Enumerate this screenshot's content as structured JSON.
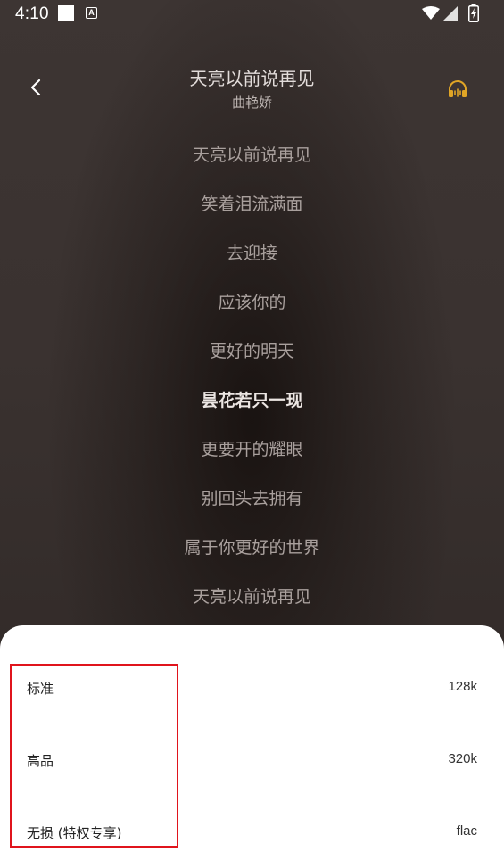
{
  "status_bar": {
    "time": "4:10",
    "a_icon_letter": "A",
    "icons": [
      "notification-square-icon",
      "a-notification-icon",
      "wifi-icon",
      "signal-icon",
      "battery-charging-icon"
    ]
  },
  "header": {
    "title": "天亮以前说再见",
    "artist": "曲艳娇",
    "back_icon": "chevron-left-icon",
    "headphones_icon": "headphones-icon"
  },
  "lyrics": {
    "lines": [
      "天亮以前说再见",
      "笑着泪流满面",
      "去迎接",
      "应该你的",
      "更好的明天",
      "昙花若只一现",
      "更要开的耀眼",
      "别回头去拥有",
      "属于你更好的世界",
      "天亮以前说再见"
    ],
    "active_index": 5
  },
  "quality_sheet": {
    "options": [
      {
        "label": "标准",
        "rate": "128k"
      },
      {
        "label": "高品",
        "rate": "320k"
      },
      {
        "label": "无损 (特权专享)",
        "rate": "flac"
      }
    ]
  },
  "colors": {
    "background": "#3a3230",
    "highlight_border": "#e0141c",
    "headphones_accent": "#e0a526",
    "sheet_background": "#ffffff"
  }
}
